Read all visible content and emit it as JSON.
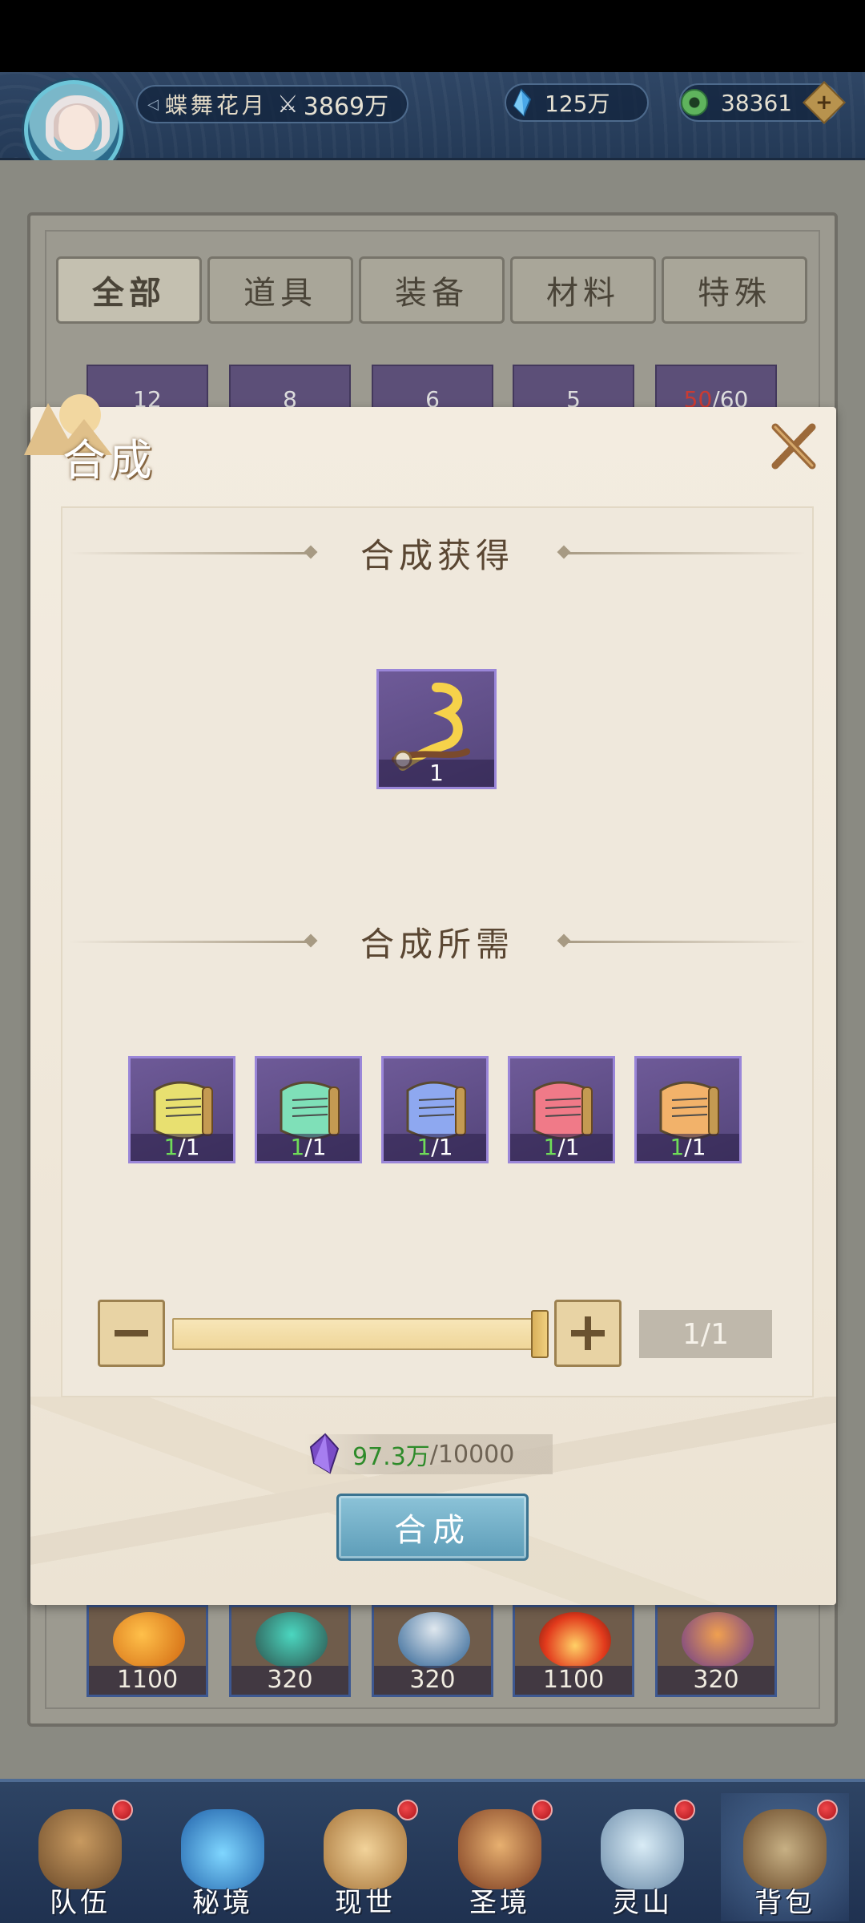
{
  "header": {
    "player_name": "蝶舞花月",
    "power": "3869万",
    "crystal": "125万",
    "jade": "38361"
  },
  "tabs": [
    {
      "label": "全部",
      "active": true
    },
    {
      "label": "道具",
      "active": false
    },
    {
      "label": "装备",
      "active": false
    },
    {
      "label": "材料",
      "active": false
    },
    {
      "label": "特殊",
      "active": false
    }
  ],
  "bag_top_row": [
    {
      "qty": "12"
    },
    {
      "qty": "8"
    },
    {
      "qty": "6"
    },
    {
      "qty": "5"
    },
    {
      "qty_have": "50",
      "qty_sep": "/60"
    }
  ],
  "bag_bottom_row": [
    {
      "qty": "1100",
      "icon": "amber-stone-icon"
    },
    {
      "qty": "320",
      "icon": "blade-icon"
    },
    {
      "qty": "320",
      "icon": "bowl-icon"
    },
    {
      "qty": "1100",
      "icon": "flame-icon"
    },
    {
      "qty": "320",
      "icon": "orb-icon"
    }
  ],
  "modal": {
    "title": "合成",
    "result_heading": "合成获得",
    "result_item": {
      "qty": "1",
      "icon": "golden-dragon-icon"
    },
    "required_heading": "合成所需",
    "required_items": [
      {
        "have": "1",
        "need": "/1",
        "color": "#e8e070"
      },
      {
        "have": "1",
        "need": "/1",
        "color": "#7fe0b8"
      },
      {
        "have": "1",
        "need": "/1",
        "color": "#8ea8f0"
      },
      {
        "have": "1",
        "need": "/1",
        "color": "#f07a88"
      },
      {
        "have": "1",
        "need": "/1",
        "color": "#f2b26a"
      }
    ],
    "count": "1/1",
    "slider_fraction": 1.0,
    "cost_have": "97.3万",
    "cost_need": "/10000",
    "confirm_label": "合成"
  },
  "nav": [
    {
      "label": "队伍",
      "dot": true,
      "active": false
    },
    {
      "label": "秘境",
      "dot": false,
      "active": false
    },
    {
      "label": "现世",
      "dot": true,
      "active": false
    },
    {
      "label": "圣境",
      "dot": true,
      "active": false
    },
    {
      "label": "灵山",
      "dot": true,
      "active": false
    },
    {
      "label": "背包",
      "dot": true,
      "active": true
    }
  ],
  "colors": {
    "accent_blue": "#5d9db8",
    "have_green": "#2e8b2a",
    "warning_red": "#c93b33"
  }
}
